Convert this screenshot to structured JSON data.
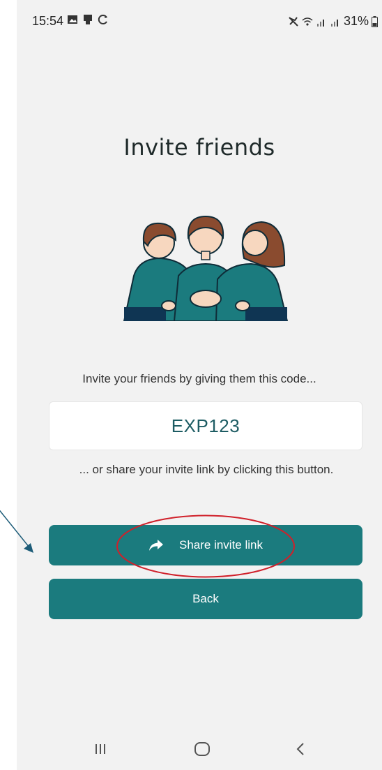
{
  "status_bar": {
    "time": "15:54",
    "battery": "31%"
  },
  "page": {
    "title": "Invite friends",
    "prompt": "Invite your friends by giving them this code...",
    "invite_code": "EXP123",
    "share_hint": "... or share your invite link by clicking this button."
  },
  "buttons": {
    "share_label": "Share invite link",
    "back_label": "Back"
  },
  "icons": {
    "status_left": [
      "gallery-icon",
      "screen-cast-icon",
      "sync-icon"
    ],
    "status_right": [
      "mute-icon",
      "wifi-icon",
      "signal-icon",
      "signal-icon",
      "battery-icon"
    ],
    "share": "share-arrow-icon",
    "nav": [
      "recent-apps-icon",
      "home-icon",
      "back-icon"
    ]
  },
  "colors": {
    "accent": "#1b7b7e",
    "background": "#f2f2f2",
    "annotation": "#d0202a"
  }
}
